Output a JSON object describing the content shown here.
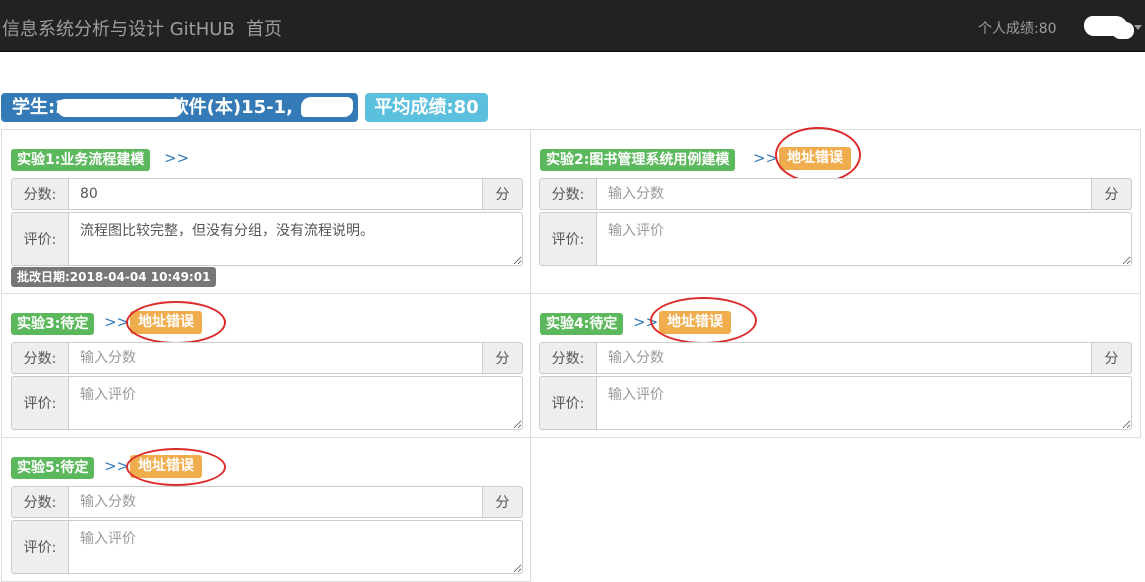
{
  "navbar": {
    "brand": "信息系统分析与设计 GitHUB",
    "home": "首页",
    "personal_score": "个人成绩:80"
  },
  "student": {
    "label": "学生:2015141??,软件(本)15-1,",
    "average": "平均成绩:80"
  },
  "common": {
    "score_label": "分数:",
    "unit_label": "分",
    "comment_label": "评价:",
    "score_placeholder": "输入分数",
    "comment_placeholder": "输入评价",
    "link_arrows": ">>",
    "error_badge": "地址错误"
  },
  "experiments": [
    {
      "title": "实验1:业务流程建模",
      "score": "80",
      "comment": "流程图比较完整，但没有分组，没有流程说明。",
      "date": "批改日期:2018-04-04 10:49:01"
    },
    {
      "title": "实验2:图书管理系统用例建模",
      "score": "",
      "comment": "",
      "error": "地址错误"
    },
    {
      "title": "实验3:待定",
      "score": "",
      "comment": "",
      "error": "地址错误"
    },
    {
      "title": "实验4:待定",
      "score": "",
      "comment": "",
      "error": "地址错误"
    },
    {
      "title": "实验5:待定",
      "score": "",
      "comment": "",
      "error": "地址错误"
    }
  ],
  "colors": {
    "navbar_bg": "#222222",
    "primary": "#337ab7",
    "info": "#5bc0de",
    "success": "#5cb85c",
    "warning": "#f0ad4e",
    "default": "#777777",
    "annotation_ring": "#dd2b2b"
  }
}
